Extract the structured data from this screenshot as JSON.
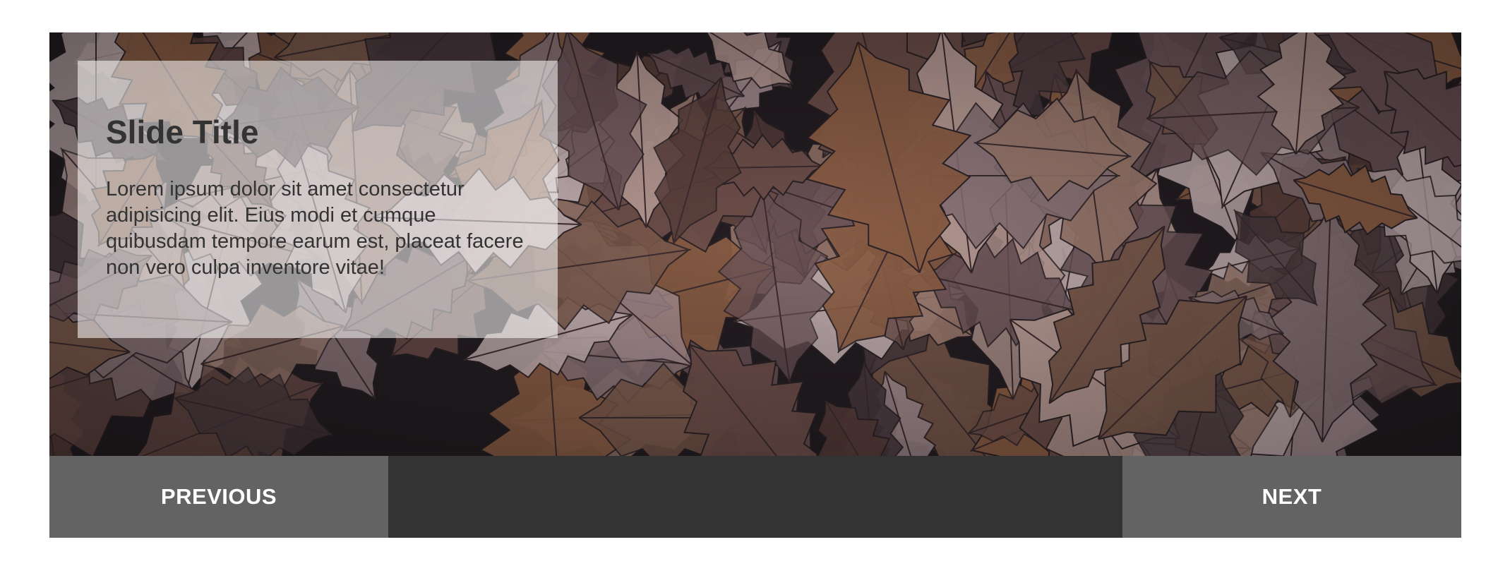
{
  "slide": {
    "title": "Slide Title",
    "text": "Lorem ipsum dolor sit amet consectetur adipisicing elit. Eius modi et cumque quibusdam tempore earum est, placeat facere non vero culpa inventore vitae!",
    "image_subject": "autumn-oak-leaves-background"
  },
  "controls": {
    "previous_label": "PREVIOUS",
    "next_label": "NEXT"
  },
  "colors": {
    "controls_bar": "#333333",
    "nav_button": "#636363",
    "nav_text": "#ffffff",
    "caption_text": "#333333"
  }
}
